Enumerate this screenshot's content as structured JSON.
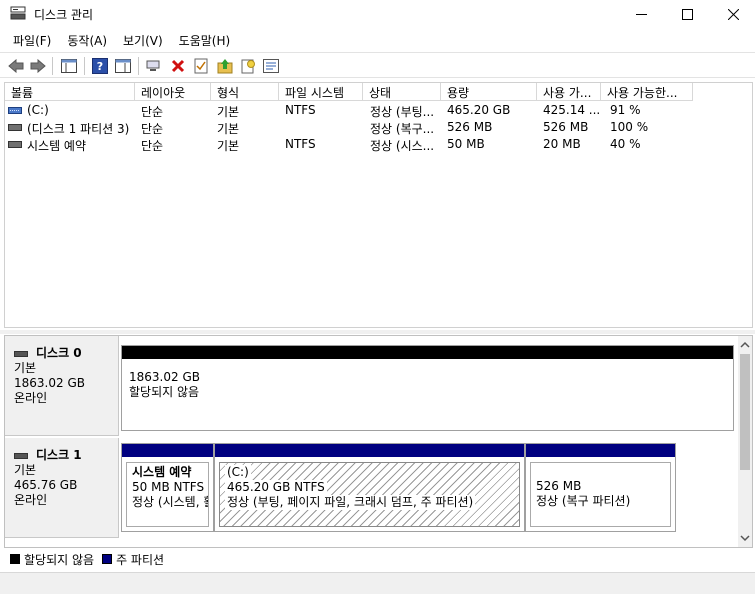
{
  "window": {
    "title": "디스크 관리",
    "minimize_icon": "minimize-icon",
    "maximize_icon": "maximize-icon",
    "close_icon": "close-icon"
  },
  "menu": [
    "파일(F)",
    "동작(A)",
    "보기(V)",
    "도움말(H)"
  ],
  "toolbar": [
    "back-arrow-icon",
    "forward-arrow-icon",
    "console-tree-icon",
    "help-icon",
    "action-pane-icon",
    "connect-icon",
    "delete-icon",
    "properties-icon",
    "up-folder-icon",
    "new-icon",
    "view-icon"
  ],
  "volume_table": {
    "columns": [
      "볼륨",
      "레이아웃",
      "형식",
      "파일 시스템",
      "상태",
      "용량",
      "사용 가...",
      "사용 가능한..."
    ],
    "rows": [
      [
        "(C:)",
        "단순",
        "기본",
        "NTFS",
        "정상 (부팅...",
        "465.20 GB",
        "425.14 ...",
        "91 %"
      ],
      [
        "(디스크 1 파티션 3)",
        "단순",
        "기본",
        "",
        "정상 (복구...",
        "526 MB",
        "526 MB",
        "100 %"
      ],
      [
        "시스템 예약",
        "단순",
        "기본",
        "NTFS",
        "정상 (시스...",
        "50 MB",
        "20 MB",
        "40 %"
      ]
    ]
  },
  "disks": [
    {
      "name": "디스크 0",
      "type": "기본",
      "size": "1863.02 GB",
      "status": "온라인",
      "partitions": [
        {
          "line1": "1863.02 GB",
          "line2": "할당되지 않음"
        }
      ]
    },
    {
      "name": "디스크 1",
      "type": "기본",
      "size": "465.76 GB",
      "status": "온라인",
      "partitions": [
        {
          "title": "시스템 예약",
          "line1": "50 MB NTFS",
          "line2": "정상 (시스템, 활"
        },
        {
          "title": "(C:)",
          "line1": "465.20 GB NTFS",
          "line2": "정상 (부팅, 페이지 파일, 크래시 덤프, 주 파티션)"
        },
        {
          "title": "",
          "line1": "526 MB",
          "line2": "정상 (복구 파티션)"
        }
      ]
    }
  ],
  "legend": [
    {
      "label": "할당되지 않음",
      "color": "#000000"
    },
    {
      "label": "주 파티션",
      "color": "#000080"
    }
  ],
  "colors": {
    "unallocated": "#000000",
    "primary": "#000080"
  }
}
